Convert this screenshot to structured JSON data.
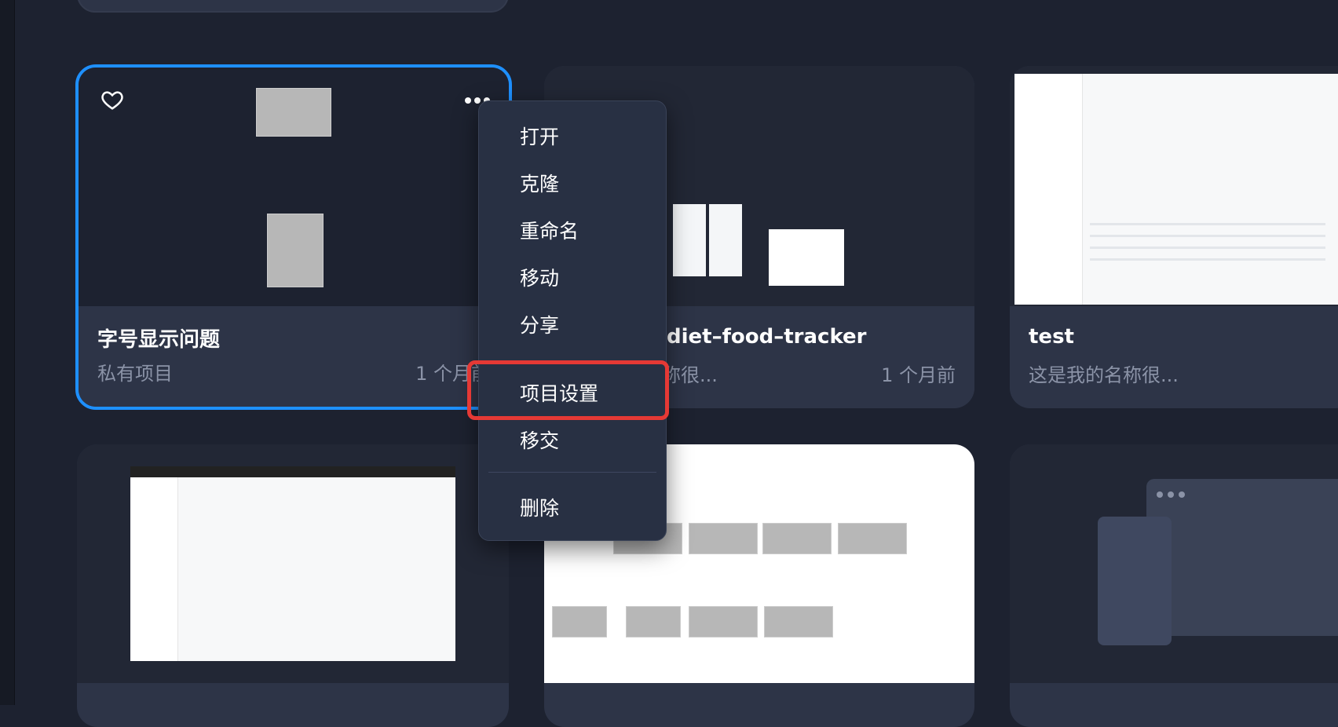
{
  "cards": [
    {
      "title": "字号显示问题",
      "subtitle": "私有项目",
      "time": "1 个月前"
    },
    {
      "title": "diet–food–tracker",
      "subtitle": "称很...",
      "time": "1 个月前"
    },
    {
      "title": "test",
      "subtitle": "这是我的名称很...",
      "time": ""
    }
  ],
  "context_menu": {
    "items": [
      "打开",
      "克隆",
      "重命名",
      "移动",
      "分享",
      "项目设置",
      "移交",
      "删除"
    ],
    "highlighted": "项目设置"
  },
  "colors": {
    "accent": "#1e90ff",
    "highlight": "#e53935",
    "background": "#1d2230",
    "card": "#2d3447"
  }
}
